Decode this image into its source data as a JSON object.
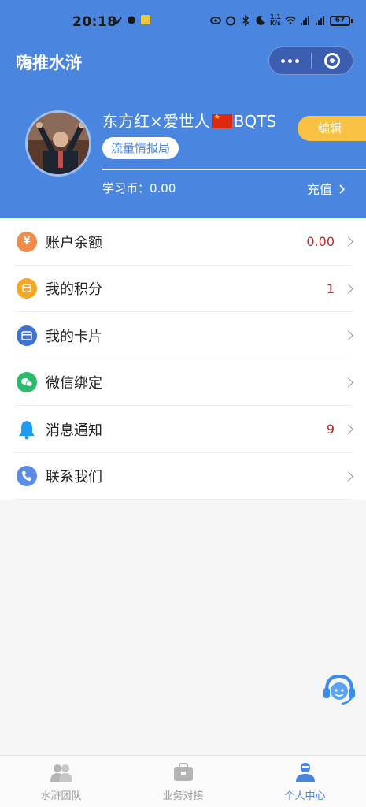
{
  "status_bar": {
    "time": "20:18",
    "net_speed_top": "1.1",
    "net_speed_bottom": "K/s",
    "battery": "67"
  },
  "header": {
    "app_title": "嗨推水浒",
    "user": {
      "name_prefix": "东方红×爱世人",
      "name_suffix": "BQTS",
      "org_tag": "流量情报局"
    },
    "edit_label": "编辑",
    "coins_label": "学习币：0.00",
    "recharge_label": "充值"
  },
  "menu": {
    "items": [
      {
        "label": "账户余额",
        "value": "0.00",
        "icon": "money-bag-icon",
        "color": "#f08b4a"
      },
      {
        "label": "我的积分",
        "value": "1",
        "icon": "coins-icon",
        "color": "#f5a623"
      },
      {
        "label": "我的卡片",
        "value": "",
        "icon": "card-icon",
        "color": "#3d72d6"
      },
      {
        "label": "微信绑定",
        "value": "",
        "icon": "wechat-icon",
        "color": "#2bb96b"
      },
      {
        "label": "消息通知",
        "value": "9",
        "icon": "bell-icon",
        "color": "#1e9cf0"
      },
      {
        "label": "联系我们",
        "value": "",
        "icon": "phone-icon",
        "color": "#5a8ee6"
      }
    ]
  },
  "tabbar": {
    "tabs": [
      {
        "label": "水浒团队",
        "icon": "team-icon",
        "active": false
      },
      {
        "label": "业务对接",
        "icon": "briefcase-icon",
        "active": false
      },
      {
        "label": "个人中心",
        "icon": "user-center-icon",
        "active": true
      }
    ]
  },
  "colors": {
    "primary": "#4a86e0",
    "edit_button": "#f7c243",
    "value_red": "#c62828"
  }
}
